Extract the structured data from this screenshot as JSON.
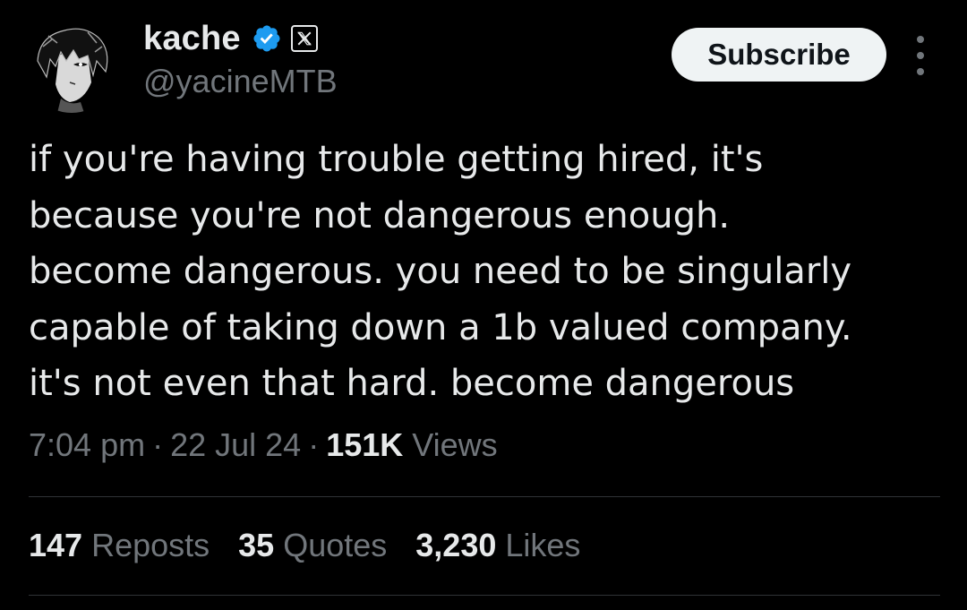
{
  "author": {
    "display_name": "kache",
    "handle": "@yacineMTB",
    "avatar_icon": "anime-avatar",
    "verified_icon": "verified-badge-icon",
    "verified_color": "#1d9bf0",
    "affiliate_icon": "x-logo-icon"
  },
  "actions": {
    "subscribe_label": "Subscribe",
    "more_icon": "more-vertical-icon"
  },
  "tweet": {
    "lines": [
      "if you're having trouble getting hired, it's",
      "because you're not dangerous enough.",
      "become dangerous. you need to be singularly",
      "capable of taking down a 1b valued company.",
      "it's not even that hard. become dangerous"
    ]
  },
  "meta": {
    "time": "7:04 pm",
    "separator": "·",
    "date": "22 Jul 24",
    "views_count": "151K",
    "views_label": "Views"
  },
  "stats": {
    "reposts_count": "147",
    "reposts_label": "Reposts",
    "quotes_count": "35",
    "quotes_label": "Quotes",
    "likes_count": "3,230",
    "likes_label": "Likes"
  },
  "colors": {
    "background": "#000000",
    "text_primary": "#e7e9ea",
    "text_secondary": "#71767b",
    "divider": "#2f3336",
    "button_bg": "#eff3f4"
  }
}
